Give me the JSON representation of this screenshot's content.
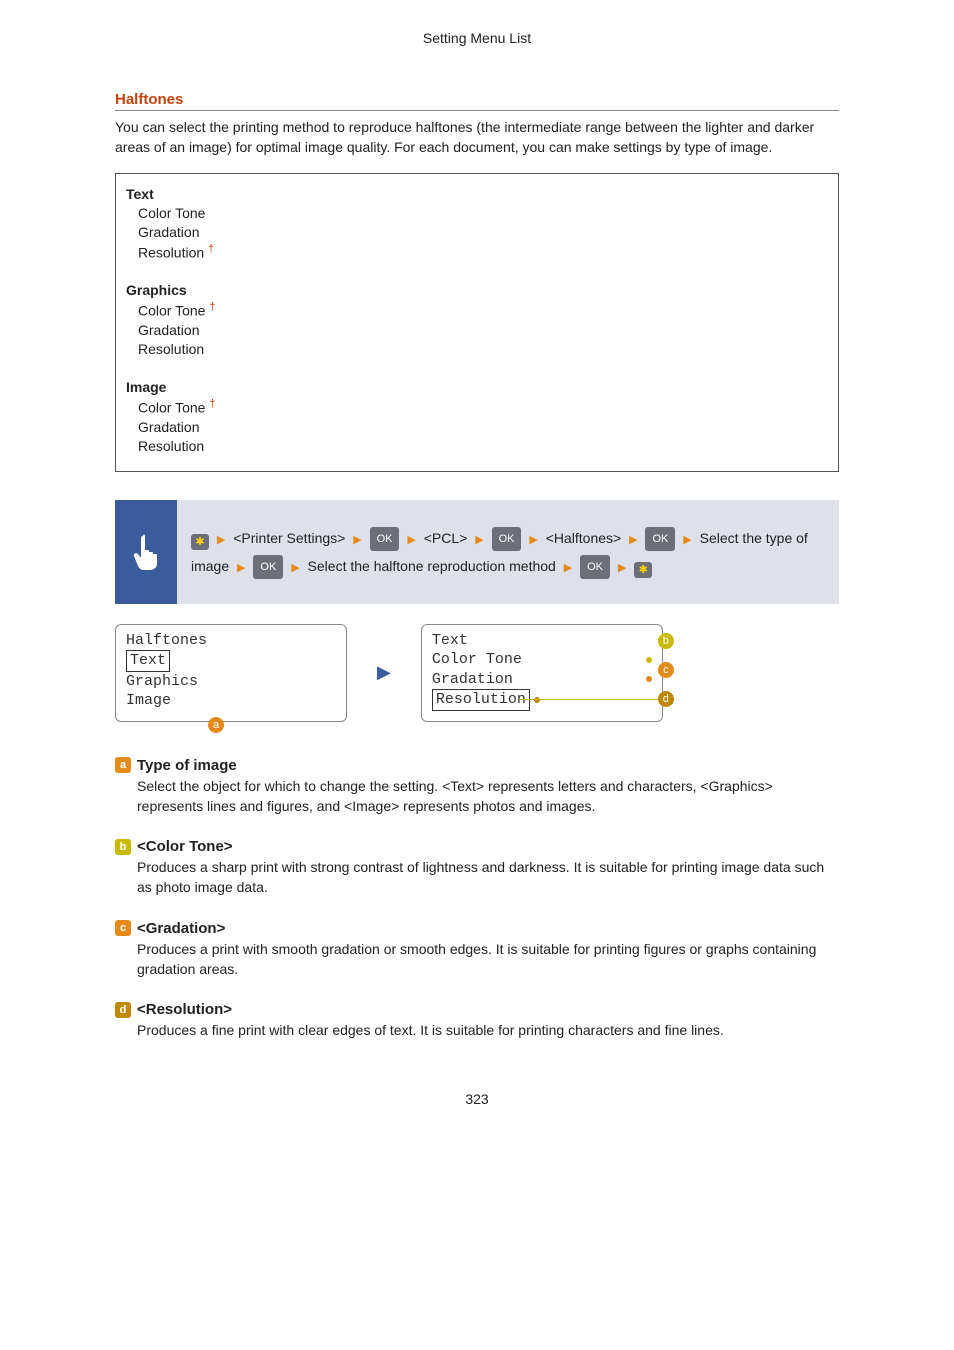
{
  "header": "Setting Menu List",
  "section": {
    "title": "Halftones",
    "intro": "You can select the printing method to reproduce halftones (the intermediate range between the lighter and darker areas of an image) for optimal image quality. For each document, you can make settings by type of image."
  },
  "settings": {
    "g1": "Text",
    "g1_i1": "Color Tone",
    "g1_i2": "Gradation",
    "g1_i3": "Resolution",
    "g2": "Graphics",
    "g2_i1": "Color Tone",
    "g2_i2": "Gradation",
    "g2_i3": "Resolution",
    "g3": "Image",
    "g3_i1": "Color Tone",
    "g3_i2": "Gradation",
    "g3_i3": "Resolution"
  },
  "nav": {
    "ok": "OK",
    "s1": "<Printer Settings>",
    "s2": "<PCL>",
    "s3": "<Halftones>",
    "s4": "Select the type of image",
    "s5": "Select the halftone reproduction method"
  },
  "screen1": {
    "title": "Halftones",
    "i1": "Text",
    "i2": "Graphics",
    "i3": "Image"
  },
  "screen2": {
    "title": "Text",
    "i1": "Color Tone",
    "i2": "Gradation",
    "i3": "Resolution"
  },
  "callouts": {
    "a": "a",
    "b": "b",
    "c": "c",
    "d": "d"
  },
  "desc": {
    "a_title": "Type of image",
    "a_body": "Select the object for which to change the setting. <Text> represents letters and characters, <Graphics> represents lines and figures, and <Image> represents photos and images.",
    "b_title": "<Color Tone>",
    "b_body": "Produces a sharp print with strong contrast of lightness and darkness. It is suitable for printing image data such as photo image data.",
    "c_title": "<Gradation>",
    "c_body": "Produces a print with smooth gradation or smooth edges. It is suitable for printing figures or graphs containing gradation areas.",
    "d_title": "<Resolution>",
    "d_body": "Produces a fine print with clear edges of text. It is suitable for printing characters and fine lines."
  },
  "page": "323"
}
